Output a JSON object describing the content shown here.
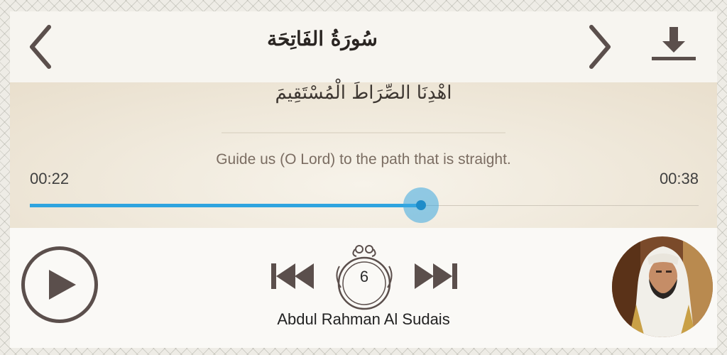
{
  "header": {
    "surah_title": "سُورَةُ الفَاتِحَة"
  },
  "icons": {
    "prev": "chevron-left-icon",
    "next": "chevron-right-icon",
    "download": "download-icon",
    "play": "play-icon",
    "skip_previous": "skip-previous-icon",
    "skip_next": "skip-next-icon",
    "repeat": "repeat-counter-icon"
  },
  "verse": {
    "arabic": "اهْدِنَا الصِّرَاطَ الْمُسْتَقِيمَ",
    "translation": "Guide us (O Lord) to the path that is straight."
  },
  "player": {
    "elapsed": "00:22",
    "total": "00:38",
    "progress": 0.585,
    "repeat_count": "6",
    "reciter": "Abdul Rahman Al Sudais"
  },
  "colors": {
    "accent": "#2fa4df",
    "icon": "#5b4f4c",
    "verse_bg": "#efe8da"
  }
}
